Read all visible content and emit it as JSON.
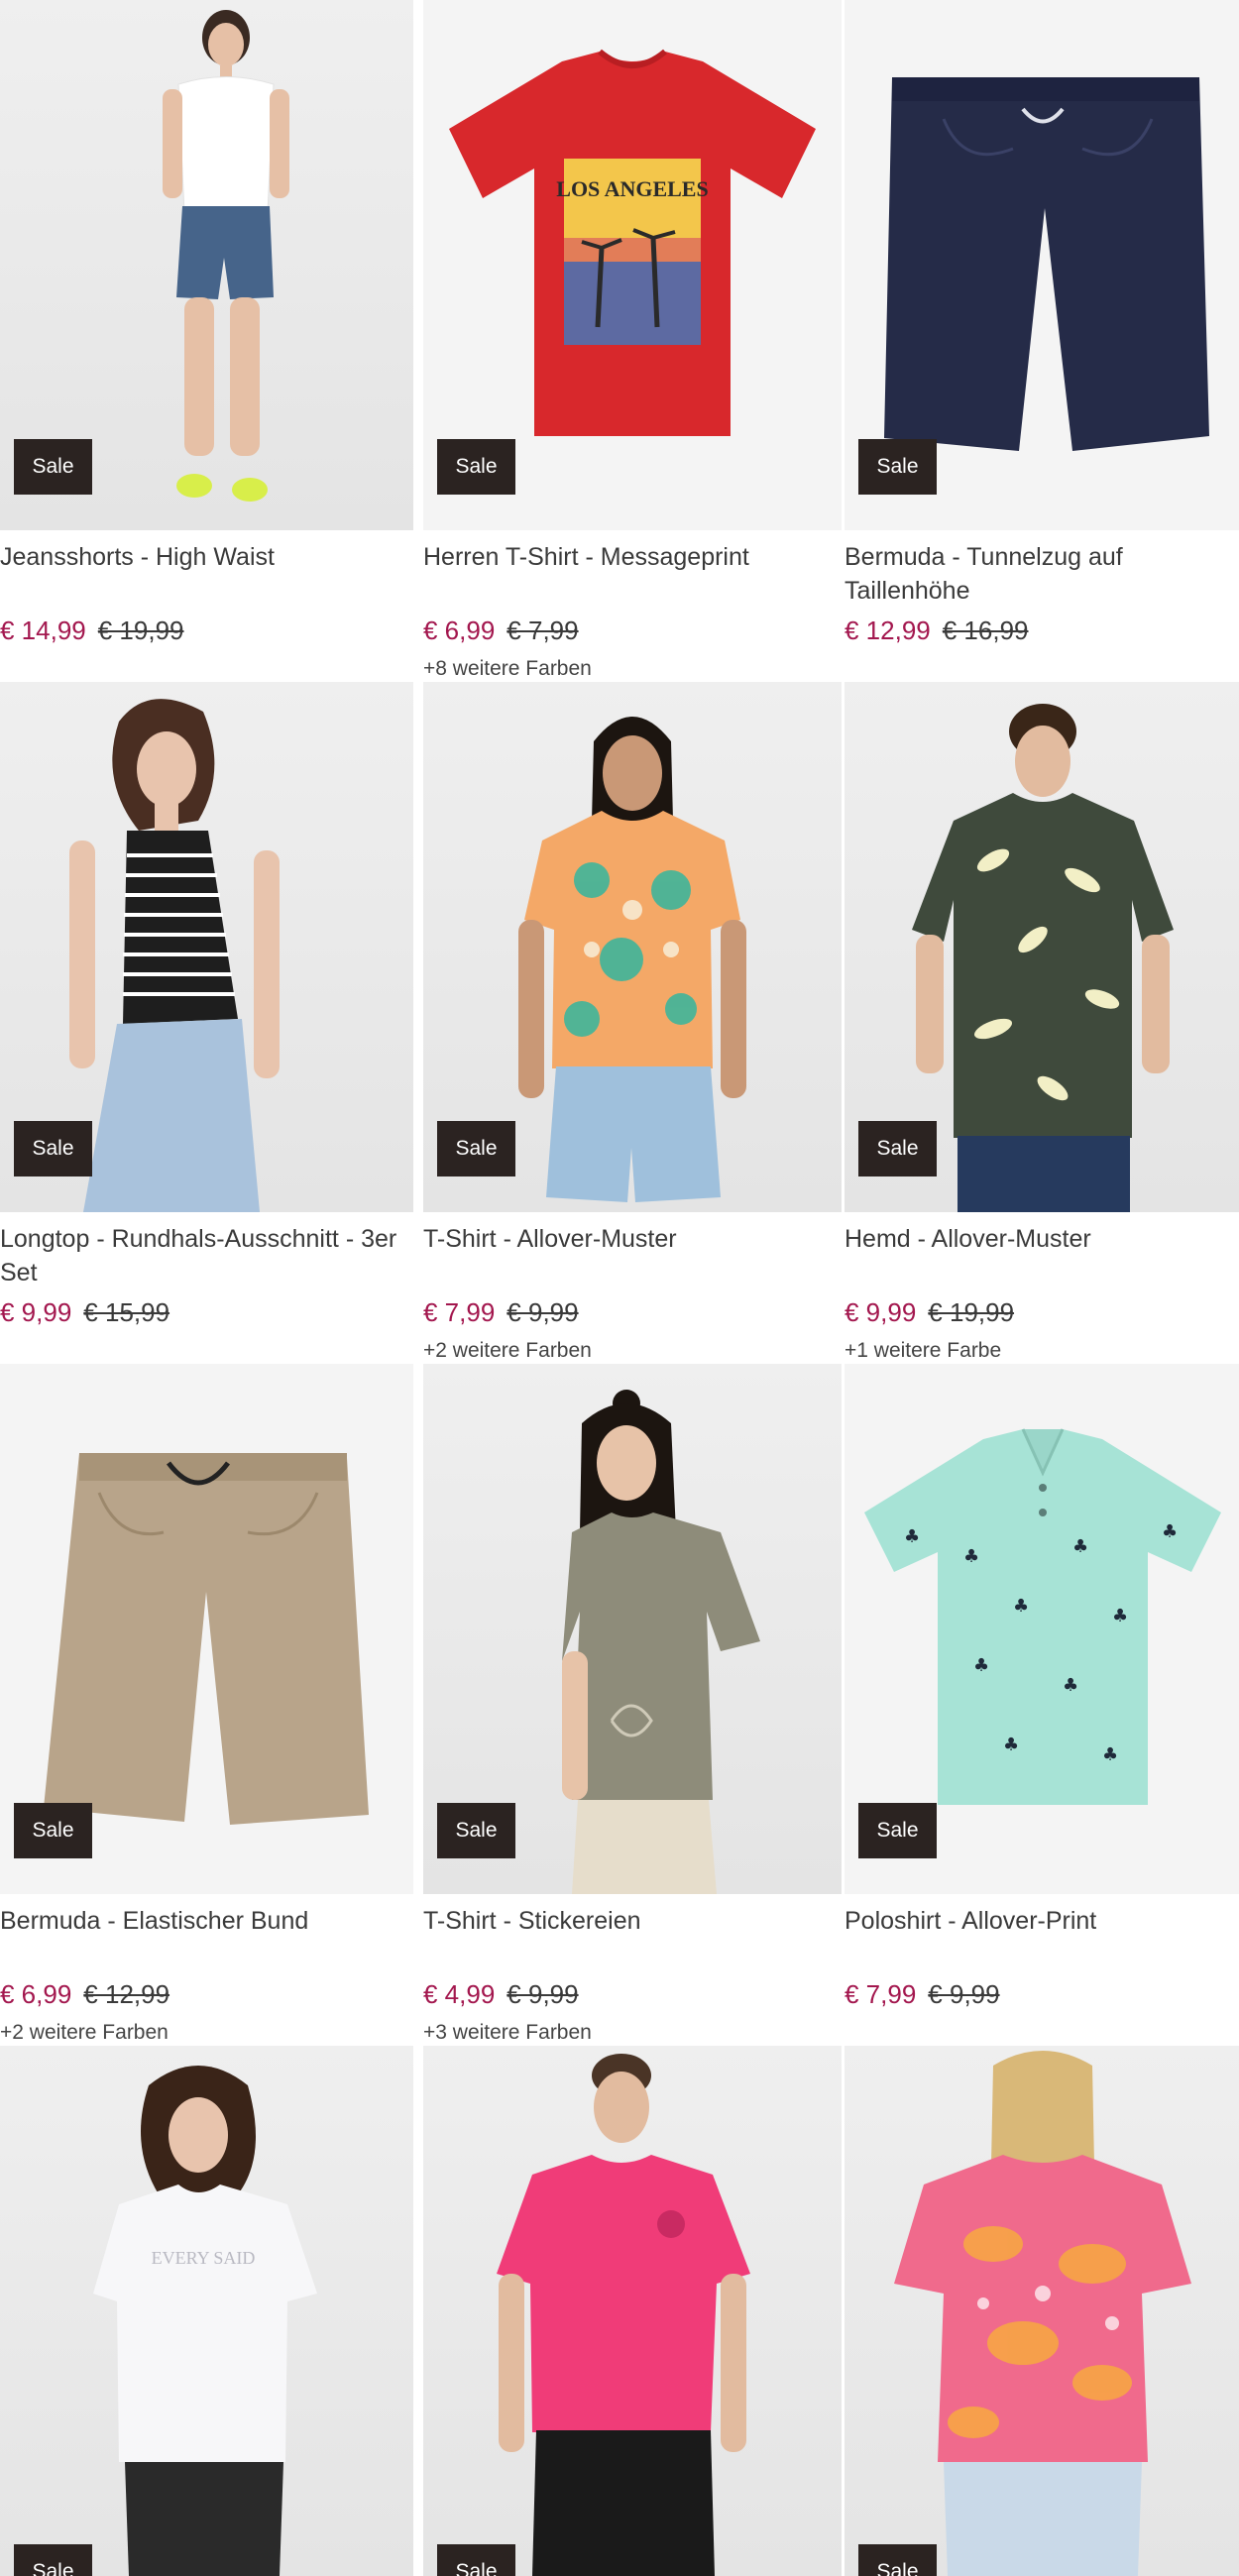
{
  "badge_label": "Sale",
  "products": [
    {
      "title": "Jeansshorts - High Waist",
      "price_now": "€ 14,99",
      "price_old": "€ 19,99",
      "colors": "",
      "image": "woman-white-tee-denim-shorts"
    },
    {
      "title": "Herren T-Shirt - Messageprint",
      "price_now": "€ 6,99",
      "price_old": "€ 7,99",
      "colors": "+8 weitere Farben",
      "image": "red-tshirt-los-angeles-print"
    },
    {
      "title": "Bermuda - Tunnelzug auf Taillenhöhe",
      "price_now": "€ 12,99",
      "price_old": "€ 16,99",
      "colors": "",
      "image": "navy-bermuda-shorts"
    },
    {
      "title": "Longtop - Rundhals-Ausschnitt - 3er Set",
      "price_now": "€ 9,99",
      "price_old": "€ 15,99",
      "colors": "",
      "image": "woman-striped-tank-top"
    },
    {
      "title": "T-Shirt - Allover-Muster",
      "price_now": "€ 7,99",
      "price_old": "€ 9,99",
      "colors": "+2 weitere Farben",
      "image": "woman-orange-pattern-tshirt"
    },
    {
      "title": "Hemd - Allover-Muster",
      "price_now": "€ 9,99",
      "price_old": "€ 19,99",
      "colors": "+1 weitere Farbe",
      "image": "man-leaf-print-shirt"
    },
    {
      "title": "Bermuda - Elastischer Bund",
      "price_now": "€ 6,99",
      "price_old": "€ 12,99",
      "colors": "+2 weitere Farben",
      "image": "beige-bermuda-shorts"
    },
    {
      "title": "T-Shirt - Stickereien",
      "price_now": "€ 4,99",
      "price_old": "€ 9,99",
      "colors": "+3 weitere Farben",
      "image": "woman-khaki-tshirt"
    },
    {
      "title": "Poloshirt - Allover-Print",
      "price_now": "€ 7,99",
      "price_old": "€ 9,99",
      "colors": "",
      "image": "mint-polo-palm-print"
    },
    {
      "title": "",
      "price_now": "",
      "price_old": "",
      "colors": "",
      "image": "woman-white-print-tshirt"
    },
    {
      "title": "",
      "price_now": "",
      "price_old": "",
      "colors": "",
      "image": "man-pink-tshirt"
    },
    {
      "title": "",
      "price_now": "",
      "price_old": "",
      "colors": "",
      "image": "woman-paisley-blouse-back"
    }
  ]
}
